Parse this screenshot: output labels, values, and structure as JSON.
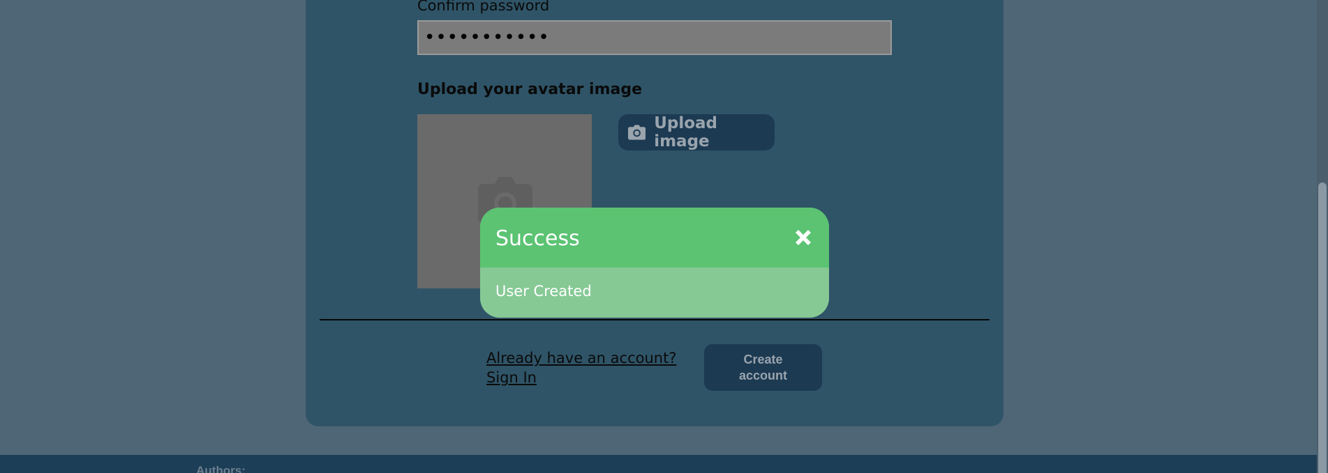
{
  "form": {
    "confirm_password_label": "Confirm password",
    "confirm_password_value": "•••••••••••",
    "avatar_label": "Upload your avatar image",
    "upload_button_label": "Upload image",
    "signin_link_text": "Already have an account? Sign In",
    "create_button_label": "Create account"
  },
  "footer": {
    "authors_label": "Authors:"
  },
  "modal": {
    "title": "Success",
    "message": "User Created"
  },
  "colors": {
    "background": "#4f6677",
    "card": "#2f5467",
    "button": "#1c3a52",
    "success_header": "#5bc372",
    "success_body": "#86c995"
  },
  "icons": {
    "upload": "camera-icon",
    "avatar_placeholder": "camera-icon",
    "close": "close-icon"
  }
}
